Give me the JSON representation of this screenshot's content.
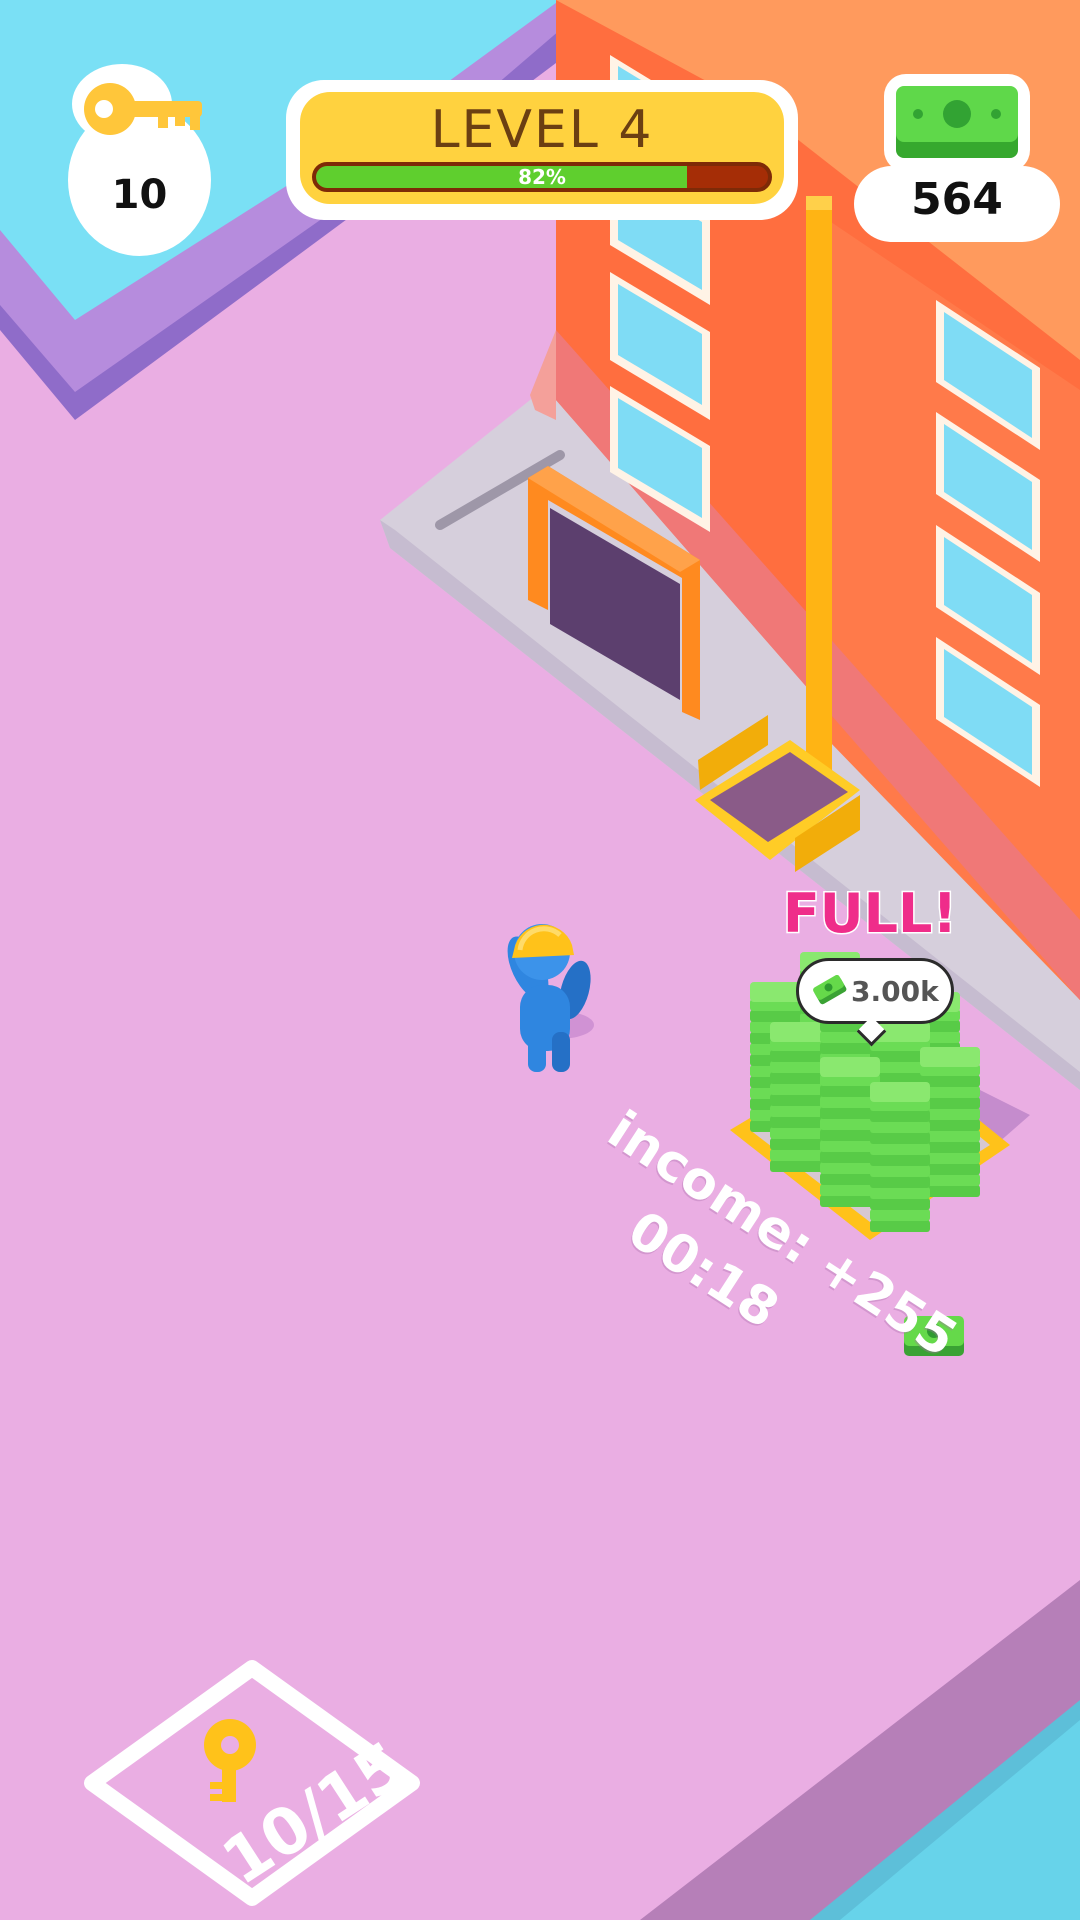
{
  "hud": {
    "keys": {
      "icon": "key-icon",
      "count": "10"
    },
    "level": {
      "title": "LEVEL 4",
      "progress": 0.82,
      "progress_label": "82%"
    },
    "cash": {
      "icon": "cash-stack-icon",
      "amount": "564"
    }
  },
  "world": {
    "money_pallet": {
      "status": "FULL!",
      "capacity_icon": "cash-icon",
      "capacity": "3.00k"
    },
    "income_label": "income: +255",
    "income_timer": "00:18",
    "key_unlock_zone": {
      "icon": "key-icon",
      "progress": "10/15"
    }
  },
  "colors": {
    "ground": "#eaaee3",
    "building": "#ff7b45",
    "accent_yellow": "#ffc21a",
    "money_green": "#65d94a",
    "progress_fill": "#5fcf2e",
    "progress_track": "#a52d06",
    "full_text": "#ef2d8a",
    "worker_blue": "#2f86e0"
  }
}
